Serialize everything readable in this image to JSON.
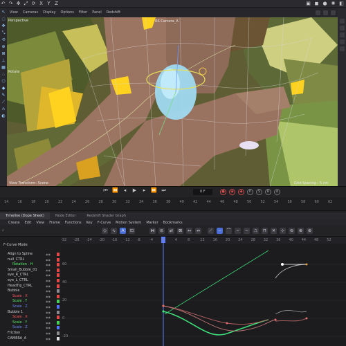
{
  "menu": {
    "items": [
      "View",
      "Cameras",
      "Display",
      "Options",
      "Filter",
      "Panel",
      "Redshift"
    ]
  },
  "viewport": {
    "projection_label": "Perspective",
    "camera_label": "RS Camera_A",
    "tool_label": "Rotate",
    "transform_label": "View Transform: Scene",
    "grid_label": "Grid Spacing : 5 cm"
  },
  "playback": {
    "frame": "0 F"
  },
  "ruler": {
    "ticks": [
      "14",
      "16",
      "18",
      "20",
      "22",
      "24",
      "26",
      "28",
      "30",
      "32",
      "34",
      "36",
      "38",
      "40",
      "42",
      "44",
      "46",
      "48",
      "50",
      "52",
      "54",
      "56",
      "58",
      "60",
      "62"
    ]
  },
  "timeline": {
    "tabs": [
      "Timeline (Dope Sheet)",
      "Node Editor",
      "Redshift Shader Graph"
    ],
    "active_tab": 0,
    "menu": [
      "Create",
      "Edit",
      "View",
      "Frame",
      "Functions",
      "Key",
      "F-Curve",
      "Motion System",
      "Marker",
      "Bookmarks"
    ],
    "mode_label": "F-Curve Mode",
    "x_ticks": [
      "-32",
      "-28",
      "-24",
      "-20",
      "-16",
      "-12",
      "-8",
      "-4",
      "0",
      "4",
      "8",
      "12",
      "16",
      "20",
      "24",
      "28",
      "32",
      "36",
      "40",
      "44",
      "48",
      "52"
    ],
    "y_ticks": [
      "60",
      "40",
      "20",
      "0",
      "-20"
    ]
  },
  "tree": {
    "rows": [
      {
        "label": "Align to Spline",
        "kind": "normal"
      },
      {
        "label": "null_CTRL",
        "kind": "normal"
      },
      {
        "label": "Rotation . H",
        "kind": "tracky"
      },
      {
        "label": "Small_Bubble_01",
        "kind": "normal"
      },
      {
        "label": "eye_R_CTRL",
        "kind": "normal"
      },
      {
        "label": "eye_L_CTRL",
        "kind": "normal"
      },
      {
        "label": "HeadTip_CTRL",
        "kind": "normal"
      },
      {
        "label": "Bubble",
        "kind": "normal"
      },
      {
        "label": "Scale . X",
        "kind": "track"
      },
      {
        "label": "Scale . Y",
        "kind": "tracky"
      },
      {
        "label": "Scale . Z",
        "kind": "trackz"
      },
      {
        "label": "Bubble 1",
        "kind": "normal"
      },
      {
        "label": "Scale . X",
        "kind": "track"
      },
      {
        "label": "Scale . Y",
        "kind": "tracky"
      },
      {
        "label": "Scale . Z",
        "kind": "trackz"
      },
      {
        "label": "Friction",
        "kind": "normal"
      },
      {
        "label": "CAMERA_A",
        "kind": "normal"
      }
    ]
  },
  "colors": {
    "accent": "#5b8cff",
    "red": "#ff5a5a",
    "green": "#5cf06a",
    "curve_green": "#3fe07a",
    "curve_red": "#c06a6a"
  }
}
